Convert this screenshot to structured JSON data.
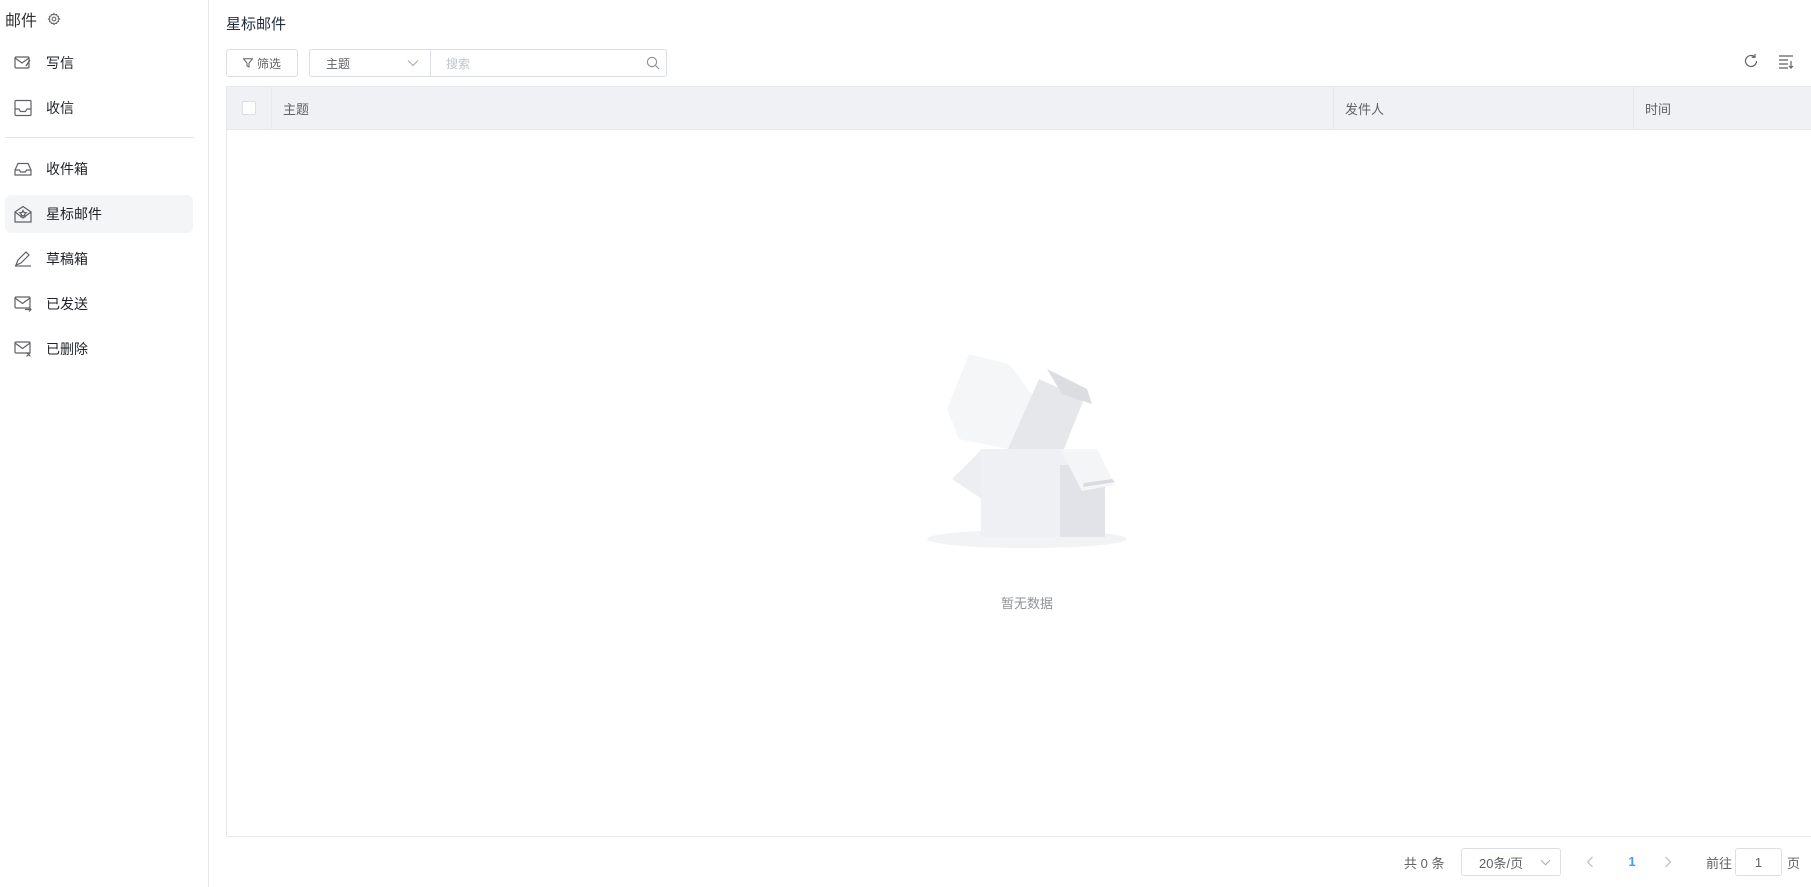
{
  "sidebar": {
    "title": "邮件",
    "actions": [
      {
        "label": "写信",
        "icon": "compose-mail-icon"
      },
      {
        "label": "收信",
        "icon": "receive-mail-icon"
      }
    ],
    "folders": [
      {
        "label": "收件箱",
        "icon": "inbox-icon",
        "active": false
      },
      {
        "label": "星标邮件",
        "icon": "starred-mail-icon",
        "active": true
      },
      {
        "label": "草稿箱",
        "icon": "drafts-icon",
        "active": false
      },
      {
        "label": "已发送",
        "icon": "sent-mail-icon",
        "active": false
      },
      {
        "label": "已删除",
        "icon": "deleted-mail-icon",
        "active": false
      }
    ]
  },
  "main": {
    "title": "星标邮件",
    "toolbar": {
      "filter_label": "筛选",
      "field_select_value": "主题",
      "search_placeholder": "搜索"
    },
    "table": {
      "columns": [
        "主题",
        "发件人",
        "时间"
      ],
      "rows": [],
      "empty_text": "暂无数据"
    },
    "pagination": {
      "total_text": "共 0 条",
      "page_size": "20条/页",
      "current_page": "1",
      "goto_label": "前往",
      "goto_value": "1",
      "goto_suffix": "页"
    }
  },
  "colors": {
    "accent": "#409eff",
    "header_bg": "#f0f1f4",
    "active_bg": "#f4f5f7",
    "border": "#dcdfe6"
  }
}
